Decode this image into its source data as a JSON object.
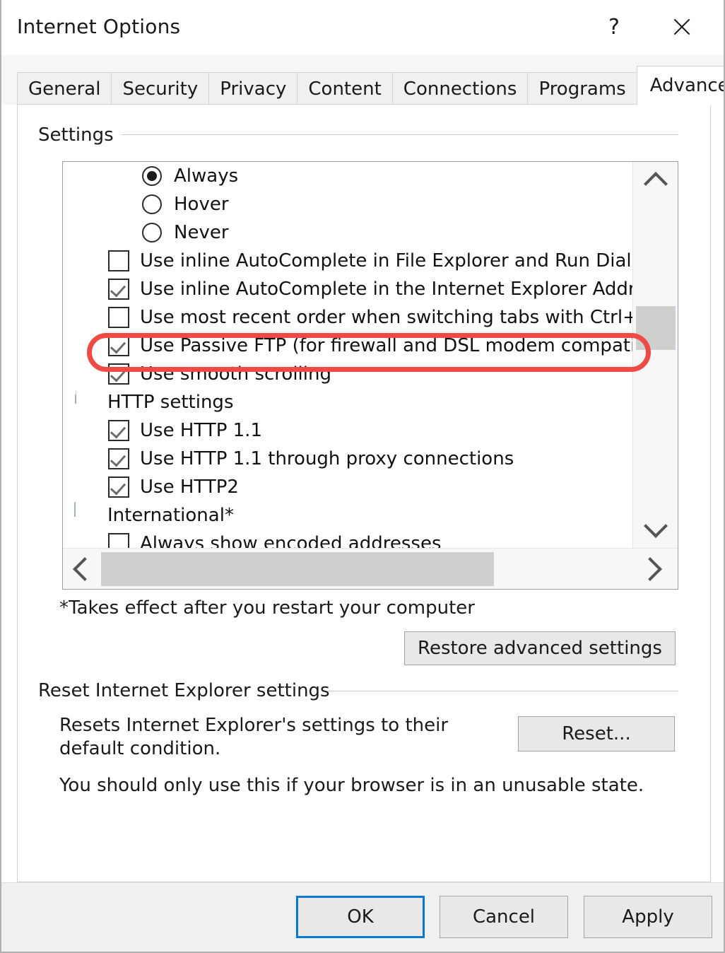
{
  "window": {
    "title": "Internet Options",
    "help_icon": "question-mark-icon",
    "close_icon": "close-icon"
  },
  "tabs": [
    {
      "label": "General",
      "selected": false
    },
    {
      "label": "Security",
      "selected": false
    },
    {
      "label": "Privacy",
      "selected": false
    },
    {
      "label": "Content",
      "selected": false
    },
    {
      "label": "Connections",
      "selected": false
    },
    {
      "label": "Programs",
      "selected": false
    },
    {
      "label": "Advanced",
      "selected": true
    }
  ],
  "settings_group": {
    "label": "Settings",
    "list": [
      {
        "type": "radio",
        "label": "Always",
        "checked": true
      },
      {
        "type": "radio",
        "label": "Hover",
        "checked": false
      },
      {
        "type": "radio",
        "label": "Never",
        "checked": false
      },
      {
        "type": "checkbox",
        "label": "Use inline AutoComplete in File Explorer and Run Dialog",
        "checked": false
      },
      {
        "type": "checkbox",
        "label": "Use inline AutoComplete in the Internet Explorer Address",
        "checked": true
      },
      {
        "type": "checkbox",
        "label": "Use most recent order when switching tabs with Ctrl+Tab",
        "checked": false
      },
      {
        "type": "checkbox",
        "label": "Use Passive FTP (for firewall and DSL modem compatibility",
        "checked": true,
        "highlighted": true
      },
      {
        "type": "checkbox",
        "label": "Use smooth scrolling",
        "checked": true
      },
      {
        "type": "category",
        "label": "HTTP settings",
        "icon": "page-icon"
      },
      {
        "type": "checkbox",
        "label": "Use HTTP 1.1",
        "checked": true
      },
      {
        "type": "checkbox",
        "label": "Use HTTP 1.1 through proxy connections",
        "checked": true
      },
      {
        "type": "checkbox",
        "label": "Use HTTP2",
        "checked": true
      },
      {
        "type": "category",
        "label": "International*",
        "icon": "window-icon"
      },
      {
        "type": "checkbox",
        "label": "Always show encoded addresses",
        "checked": false
      }
    ],
    "vertical_scrollbar": {
      "up_icon": "chevron-up-icon",
      "down_icon": "chevron-down-icon"
    },
    "horizontal_scrollbar": {
      "left_icon": "chevron-left-icon",
      "right_icon": "chevron-right-icon"
    },
    "footnote": "*Takes effect after you restart your computer",
    "restore_button": "Restore advanced settings"
  },
  "reset_group": {
    "label": "Reset Internet Explorer settings",
    "description": "Resets Internet Explorer's settings to their default condition.",
    "reset_button": "Reset...",
    "warning": "You should only use this if your browser is in an unusable state."
  },
  "footer": {
    "ok": "OK",
    "cancel": "Cancel",
    "apply": "Apply"
  },
  "colors": {
    "highlight": "#f04a44",
    "focus": "#0b78d0",
    "dialog_bg": "#ffffff",
    "footer_bg": "#f0f0f0"
  }
}
